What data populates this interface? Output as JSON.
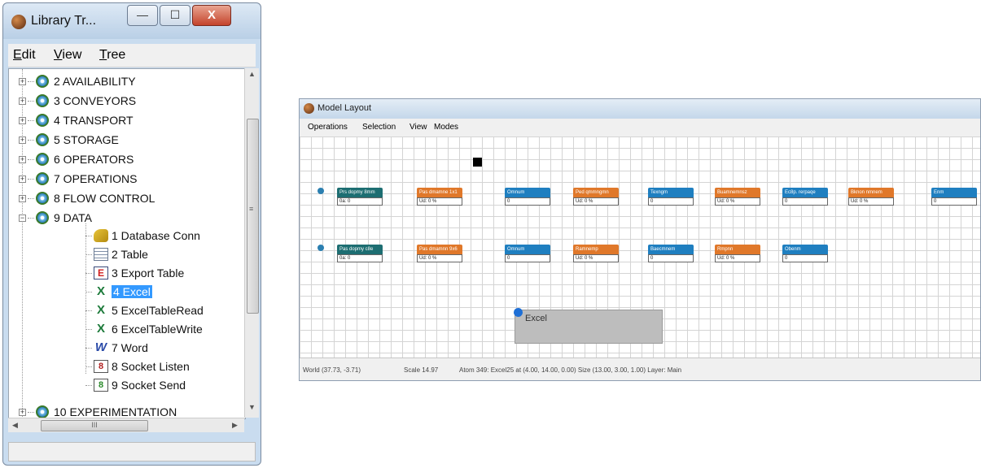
{
  "library_window": {
    "title": "Library Tr...",
    "controls": {
      "minimize": "—",
      "maximize": "☐",
      "close": "X"
    },
    "menu": [
      {
        "label": "Edit",
        "key": "E",
        "rest": "dit"
      },
      {
        "label": "View",
        "key": "V",
        "rest": "iew"
      },
      {
        "label": "Tree",
        "key": "T",
        "rest": "ree"
      }
    ],
    "tree": {
      "folders_top": [
        {
          "expander": "+",
          "label": "2 AVAILABILITY"
        },
        {
          "expander": "+",
          "label": "3 CONVEYORS"
        },
        {
          "expander": "+",
          "label": "4 TRANSPORT"
        },
        {
          "expander": "+",
          "label": "5 STORAGE"
        },
        {
          "expander": "+",
          "label": "6 OPERATORS"
        },
        {
          "expander": "+",
          "label": "7 OPERATIONS"
        },
        {
          "expander": "+",
          "label": "8 FLOW CONTROL"
        },
        {
          "expander": "−",
          "label": "9 DATA"
        }
      ],
      "data_children": [
        {
          "icon": "key-icon",
          "label": "1 Database Conn"
        },
        {
          "icon": "table-icon",
          "label": "2 Table"
        },
        {
          "icon": "export-table-icon",
          "glyph": "E",
          "label": "3 Export Table"
        },
        {
          "icon": "excel-icon",
          "glyph": "X",
          "label": "4 Excel",
          "selected": true
        },
        {
          "icon": "excel-icon",
          "glyph": "X",
          "label": "5 ExcelTableRead"
        },
        {
          "icon": "excel-icon",
          "glyph": "X",
          "label": "6 ExcelTableWrite"
        },
        {
          "icon": "word-icon",
          "glyph": "W",
          "label": "7 Word"
        },
        {
          "icon": "socket-listen-icon",
          "glyph": "8",
          "label": "8 Socket Listen"
        },
        {
          "icon": "socket-send-icon",
          "glyph": "8",
          "label": "9 Socket Send"
        }
      ],
      "folder_bottom": {
        "expander": "+",
        "label": "10 EXPERIMENTATION"
      }
    },
    "hscroll_grip": "III",
    "vscroll_grip": "≡"
  },
  "model_window": {
    "title": "Model Layout",
    "menu": [
      "Operations",
      "Selection",
      "View",
      "Modes"
    ],
    "row1": [
      {
        "color": "teal",
        "header": "Prs dopmy 8mm",
        "value": "0a: 0"
      },
      {
        "color": "orange",
        "header": "Pas dmamne 1x1",
        "value": "Ud: 0 %"
      },
      {
        "color": "blue",
        "header": "Omnum",
        "value": "0"
      },
      {
        "color": "orange",
        "header": "Ped qmmngmn",
        "value": "Ud: 0 %"
      },
      {
        "color": "blue",
        "header": "Texngm",
        "value": "0"
      },
      {
        "color": "orange",
        "header": "Buamnemnsz",
        "value": "Ud: 0 %"
      },
      {
        "color": "blue",
        "header": "Ec8p. rerpaqe",
        "value": "0"
      },
      {
        "color": "orange",
        "header": "Bknon nmnem",
        "value": "Ud: 0 %"
      },
      {
        "color": "blue",
        "header": "Enm",
        "value": "0"
      }
    ],
    "row2": [
      {
        "color": "teal",
        "header": "Pas dopmy c8e",
        "value": "0a: 0"
      },
      {
        "color": "orange",
        "header": "Pas dmamnn 9x6",
        "value": "Ud: 0 %"
      },
      {
        "color": "blue",
        "header": "Omnum",
        "value": "0"
      },
      {
        "color": "orange",
        "header": "Ramnemp",
        "value": "Ud: 0 %"
      },
      {
        "color": "blue",
        "header": "Baecmnem",
        "value": "0"
      },
      {
        "color": "orange",
        "header": "Rmpnn",
        "value": "Ud: 0 %"
      },
      {
        "color": "blue",
        "header": "Obenm",
        "value": "0"
      }
    ],
    "excel_atom_label": "Excel",
    "status": {
      "world": "World (37.73, -3.71)",
      "scale": "Scale 14.97",
      "atom_info": "Atom 349: Excel25 at (4.00, 14.00, 0.00) Size (13.00, 3.00, 1.00) Layer: Main"
    }
  }
}
